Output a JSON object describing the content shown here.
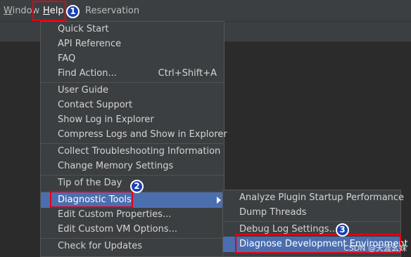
{
  "menubar": {
    "window_label": "Window",
    "help_label": "Help",
    "reservation_label": "Reservation"
  },
  "help_menu": {
    "items": [
      {
        "label": "Quick Start"
      },
      {
        "label": "API Reference"
      },
      {
        "label": "FAQ"
      },
      {
        "label": "Find Action...",
        "shortcut": "Ctrl+Shift+A"
      },
      {
        "label": "User Guide"
      },
      {
        "label": "Contact Support"
      },
      {
        "label": "Show Log in Explorer"
      },
      {
        "label": "Compress Logs and Show in Explorer"
      },
      {
        "label": "Collect Troubleshooting Information"
      },
      {
        "label": "Change Memory Settings"
      },
      {
        "label": "Tip of the Day"
      },
      {
        "label": "Diagnostic Tools"
      },
      {
        "label": "Edit Custom Properties..."
      },
      {
        "label": "Edit Custom VM Options..."
      },
      {
        "label": "Check for Updates"
      }
    ]
  },
  "diagnostic_submenu": {
    "items": [
      {
        "label": "Analyze Plugin Startup Performance"
      },
      {
        "label": "Dump Threads"
      },
      {
        "label": "Debug Log Settings..."
      },
      {
        "label": "Diagnose Development Environment"
      }
    ]
  },
  "annotations": {
    "step1": "1",
    "step2": "2",
    "step3": "3"
  },
  "watermark": "CSDN @天涯幺妹",
  "colors": {
    "menubar_bg": "#3c3f41",
    "menu_bg": "#3c3f41",
    "selection": "#4b6eaf",
    "annotation_red": "#e60012",
    "badge_blue": "#1a3fb0"
  }
}
